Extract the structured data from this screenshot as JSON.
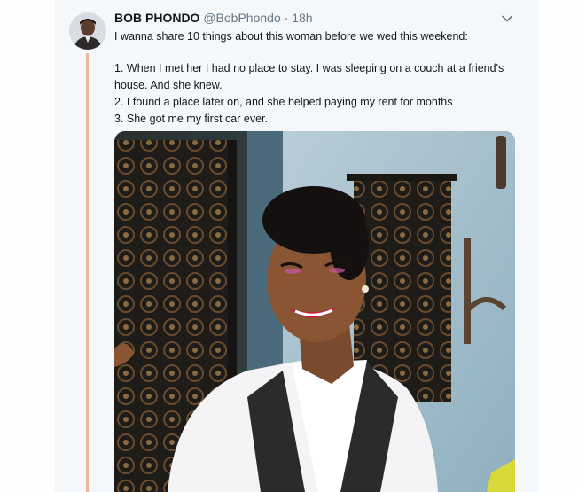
{
  "tweet": {
    "author_name": "BOB PHONDO",
    "handle": "@BobPhondo",
    "separator": "·",
    "time": "18h",
    "lines": [
      "I wanna share 10 things about this woman before we wed this weekend:",
      "1. When I met her I had no place to stay. I was sleeping on a couch at a friend's house. And she knew.",
      "2. I found a place later on, and she helped paying my rent for months",
      "3. She got me my first car ever."
    ]
  },
  "colors": {
    "thread_line": "#f0b7a0",
    "tweet_background": "#f5f8fa",
    "secondary_text": "#657786"
  },
  "icons": {
    "menu": "chevron-down-icon"
  }
}
